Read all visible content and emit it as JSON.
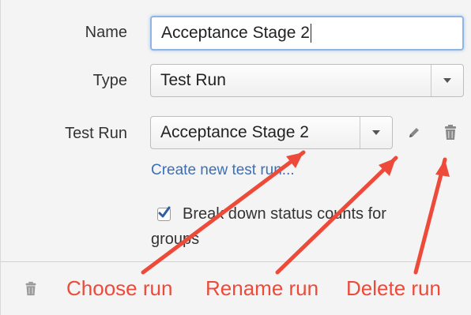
{
  "form": {
    "name_label": "Name",
    "name_value": "Acceptance Stage 2",
    "type_label": "Type",
    "type_value": "Test Run",
    "testrun_label": "Test Run",
    "testrun_value": "Acceptance Stage 2",
    "create_link": "Create new test run...",
    "breakdown_label": "Break down status counts for groups",
    "breakdown_checked": true
  },
  "annotations": {
    "choose": "Choose run",
    "rename": "Rename run",
    "delete": "Delete run"
  },
  "colors": {
    "annotation": "#ee4a3a",
    "link": "#3b6fb6"
  },
  "icons": {
    "rename": "pencil-icon",
    "delete": "trash-icon",
    "footer_delete": "trash-icon"
  }
}
